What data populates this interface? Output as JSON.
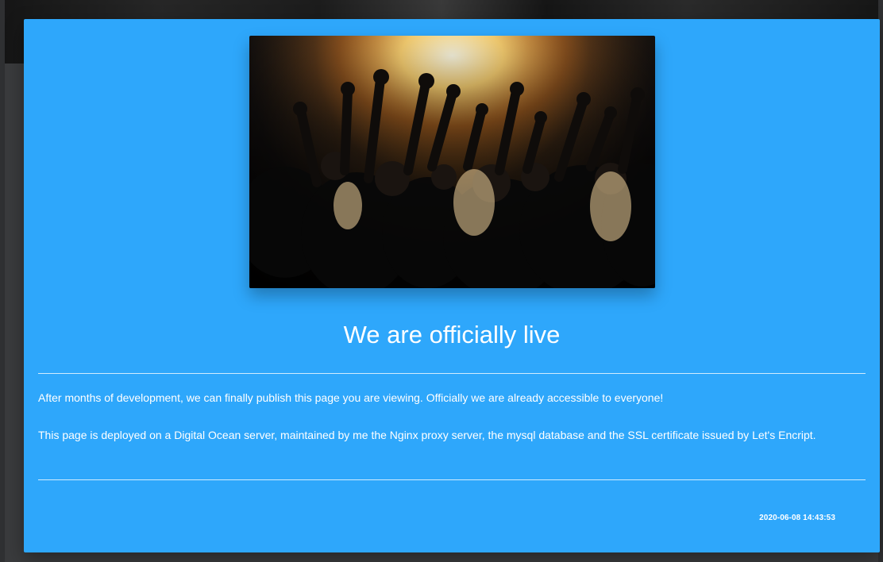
{
  "hero": {
    "image_description": "Concert crowd with hands raised under bright stage lights"
  },
  "content": {
    "title": "We are officially live",
    "paragraph_1": "After months of development, we can finally publish this page you are viewing. Officially we are already accessible to everyone!",
    "paragraph_2": "This page is deployed on a Digital Ocean server, maintained by me the Nginx proxy server, the mysql database and the SSL certificate issued by Let's Encript.",
    "timestamp": "2020-06-08 14:43:53"
  },
  "colors": {
    "modal_bg": "#2ea7fb",
    "text": "#ffffff",
    "backdrop": "#2f3032"
  }
}
